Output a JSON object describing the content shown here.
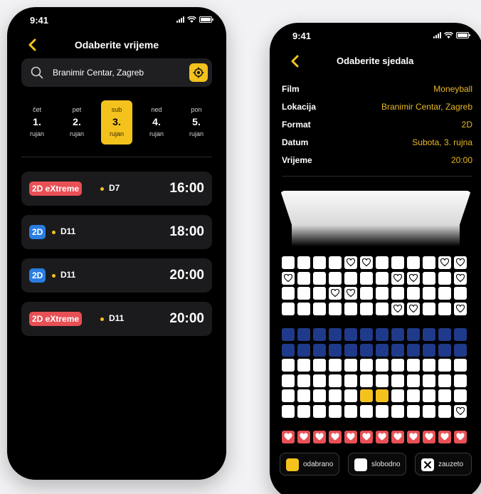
{
  "left_screen": {
    "status_time": "9:41",
    "title": "Odaberite vrijeme",
    "search_value": "Branimir Centar, Zagreb",
    "days": [
      {
        "name": "čet",
        "num": "1.",
        "month": "rujan",
        "selected": false
      },
      {
        "name": "pet",
        "num": "2.",
        "month": "rujan",
        "selected": false
      },
      {
        "name": "sub",
        "num": "3.",
        "month": "rujan",
        "selected": true
      },
      {
        "name": "ned",
        "num": "4.",
        "month": "rujan",
        "selected": false
      },
      {
        "name": "pon",
        "num": "5.",
        "month": "rujan",
        "selected": false
      }
    ],
    "showtimes": [
      {
        "format": "2D eXtreme",
        "format_color": "red",
        "hall": "D7",
        "time": "16:00"
      },
      {
        "format": "2D",
        "format_color": "blue",
        "hall": "D11",
        "time": "18:00"
      },
      {
        "format": "2D",
        "format_color": "blue",
        "hall": "D11",
        "time": "20:00"
      },
      {
        "format": "2D eXtreme",
        "format_color": "red",
        "hall": "D11",
        "time": "20:00"
      }
    ]
  },
  "right_screen": {
    "status_time": "9:41",
    "title": "Odaberite sjedala",
    "info": [
      {
        "label": "Film",
        "value": "Moneyball"
      },
      {
        "label": "Lokacija",
        "value": "Branimir Centar, Zagreb"
      },
      {
        "label": "Format",
        "value": "2D"
      },
      {
        "label": "Datum",
        "value": "Subota, 3. rujna"
      },
      {
        "label": "Vrijeme",
        "value": "20:00"
      }
    ],
    "seat_rows": [
      "WWWWhhWWWWhh",
      "hWWWWWWhhWWh",
      "WWWhhWWWWWWW",
      "WWWWWWWhhWWh",
      "",
      "NNNNNNNNNNNN",
      "NNNNNNNNNNNN",
      "WWWWWWWWWWWW",
      "WWWWWWWWWWWW",
      "WWWWWYYWWWWW",
      "WWWWWWWWWWWh",
      "",
      "RRRRRRRRRRRR"
    ],
    "legend": [
      {
        "label": "odabrano",
        "swatch": "yellow"
      },
      {
        "label": "slobodno",
        "swatch": "white"
      },
      {
        "label": "zauzeto",
        "swatch": "x"
      }
    ],
    "colors": {
      "accent": "#f4c21d",
      "navy_seat": "#1f3a8a",
      "vip_seat": "#e85055",
      "free_seat": "#ffffff"
    }
  }
}
